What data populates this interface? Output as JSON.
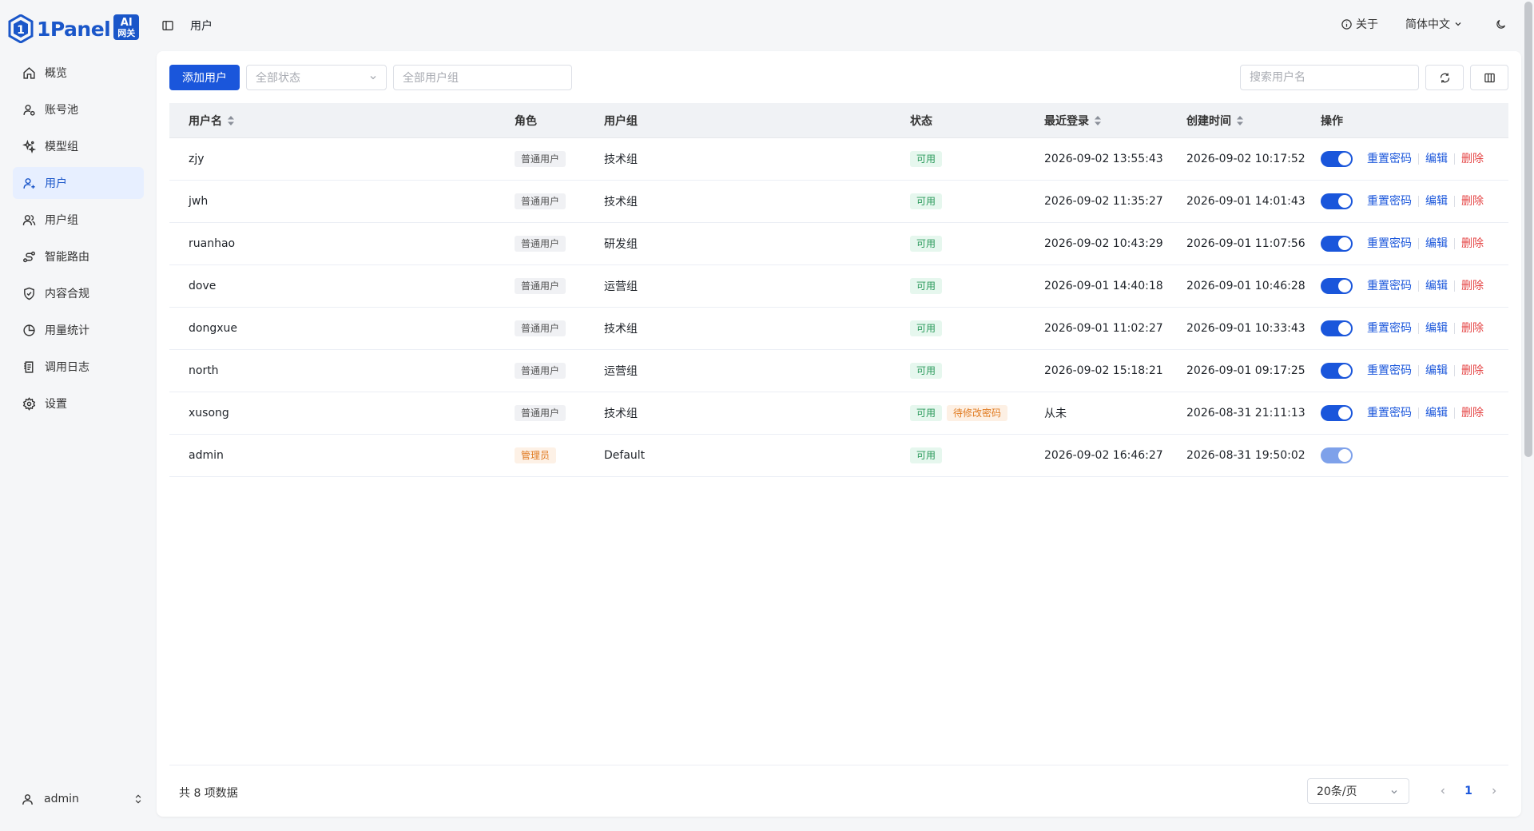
{
  "brand": {
    "name": "1Panel",
    "badge_line1": "AI",
    "badge_line2": "网关"
  },
  "sidebar": {
    "items": [
      {
        "label": "概览",
        "icon": "home-icon"
      },
      {
        "label": "账号池",
        "icon": "account-pool-icon"
      },
      {
        "label": "模型组",
        "icon": "model-group-icon"
      },
      {
        "label": "用户",
        "icon": "user-add-icon",
        "active": true
      },
      {
        "label": "用户组",
        "icon": "users-icon"
      },
      {
        "label": "智能路由",
        "icon": "route-icon"
      },
      {
        "label": "内容合规",
        "icon": "shield-check-icon"
      },
      {
        "label": "用量统计",
        "icon": "pie-chart-icon"
      },
      {
        "label": "调用日志",
        "icon": "log-icon"
      },
      {
        "label": "设置",
        "icon": "gear-icon"
      }
    ],
    "current_user": "admin"
  },
  "header": {
    "breadcrumb": "用户",
    "about": "关于",
    "language": "简体中文"
  },
  "toolbar": {
    "add_user": "添加用户",
    "status_filter_placeholder": "全部状态",
    "group_filter_placeholder": "全部用户组",
    "search_placeholder": "搜索用户名"
  },
  "table": {
    "columns": [
      "用户名",
      "角色",
      "用户组",
      "状态",
      "最近登录",
      "创建时间",
      "操作"
    ],
    "op_labels": {
      "reset": "重置密码",
      "edit": "编辑",
      "delete": "删除"
    },
    "rows": [
      {
        "username": "zjy",
        "role": "普通用户",
        "group": "技术组",
        "status": "可用",
        "extra_status": "",
        "last_login": "2026-09-02 13:55:43",
        "created": "2026-09-02 10:17:52",
        "enabled": true,
        "is_admin": false
      },
      {
        "username": "jwh",
        "role": "普通用户",
        "group": "技术组",
        "status": "可用",
        "extra_status": "",
        "last_login": "2026-09-02 11:35:27",
        "created": "2026-09-01 14:01:43",
        "enabled": true,
        "is_admin": false
      },
      {
        "username": "ruanhao",
        "role": "普通用户",
        "group": "研发组",
        "status": "可用",
        "extra_status": "",
        "last_login": "2026-09-02 10:43:29",
        "created": "2026-09-01 11:07:56",
        "enabled": true,
        "is_admin": false
      },
      {
        "username": "dove",
        "role": "普通用户",
        "group": "运营组",
        "status": "可用",
        "extra_status": "",
        "last_login": "2026-09-01 14:40:18",
        "created": "2026-09-01 10:46:28",
        "enabled": true,
        "is_admin": false
      },
      {
        "username": "dongxue",
        "role": "普通用户",
        "group": "技术组",
        "status": "可用",
        "extra_status": "",
        "last_login": "2026-09-01 11:02:27",
        "created": "2026-09-01 10:33:43",
        "enabled": true,
        "is_admin": false
      },
      {
        "username": "north",
        "role": "普通用户",
        "group": "运营组",
        "status": "可用",
        "extra_status": "",
        "last_login": "2026-09-02 15:18:21",
        "created": "2026-09-01 09:17:25",
        "enabled": true,
        "is_admin": false
      },
      {
        "username": "xusong",
        "role": "普通用户",
        "group": "技术组",
        "status": "可用",
        "extra_status": "待修改密码",
        "last_login": "从未",
        "created": "2026-08-31 21:11:13",
        "enabled": true,
        "is_admin": false
      },
      {
        "username": "admin",
        "role": "管理员",
        "group": "Default",
        "status": "可用",
        "extra_status": "",
        "last_login": "2026-09-02 16:46:27",
        "created": "2026-08-31 19:50:02",
        "enabled": true,
        "is_admin": true
      }
    ]
  },
  "footer": {
    "total": "共 8 项数据",
    "page_size": "20条/页",
    "current_page": "1"
  },
  "colors": {
    "primary": "#1a56db",
    "danger": "#e54545",
    "success": "#2a9a5b",
    "warning": "#e07b21"
  }
}
